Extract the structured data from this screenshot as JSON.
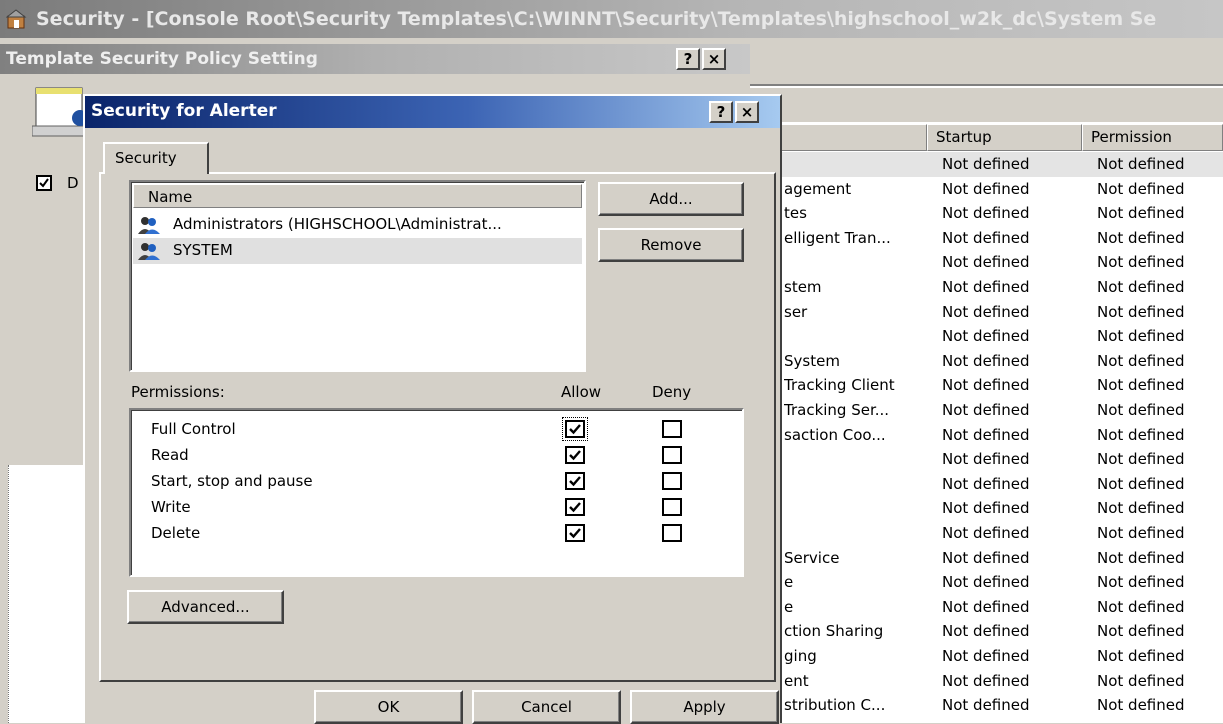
{
  "main_window": {
    "title": "Security - [Console Root\\Security Templates\\C:\\WINNT\\Security\\Templates\\highschool_w2k_dc\\System Se"
  },
  "services_list": {
    "columns": [
      "Startup",
      "Permission"
    ],
    "rows": [
      {
        "name": "",
        "startup": "Not defined",
        "permission": "Not defined"
      },
      {
        "name": "agement",
        "startup": "Not defined",
        "permission": "Not defined"
      },
      {
        "name": "tes",
        "startup": "Not defined",
        "permission": "Not defined"
      },
      {
        "name": "elligent Tran...",
        "startup": "Not defined",
        "permission": "Not defined"
      },
      {
        "name": "",
        "startup": "Not defined",
        "permission": "Not defined"
      },
      {
        "name": "stem",
        "startup": "Not defined",
        "permission": "Not defined"
      },
      {
        "name": "ser",
        "startup": "Not defined",
        "permission": "Not defined"
      },
      {
        "name": "",
        "startup": "Not defined",
        "permission": "Not defined"
      },
      {
        "name": "System",
        "startup": "Not defined",
        "permission": "Not defined"
      },
      {
        "name": "Tracking Client",
        "startup": "Not defined",
        "permission": "Not defined"
      },
      {
        "name": "Tracking Ser...",
        "startup": "Not defined",
        "permission": "Not defined"
      },
      {
        "name": "saction Coo...",
        "startup": "Not defined",
        "permission": "Not defined"
      },
      {
        "name": "",
        "startup": "Not defined",
        "permission": "Not defined"
      },
      {
        "name": "",
        "startup": "Not defined",
        "permission": "Not defined"
      },
      {
        "name": "",
        "startup": "Not defined",
        "permission": "Not defined"
      },
      {
        "name": "",
        "startup": "Not defined",
        "permission": "Not defined"
      },
      {
        "name": "Service",
        "startup": "Not defined",
        "permission": "Not defined"
      },
      {
        "name": "e",
        "startup": "Not defined",
        "permission": "Not defined"
      },
      {
        "name": "e",
        "startup": "Not defined",
        "permission": "Not defined"
      },
      {
        "name": "ction Sharing",
        "startup": "Not defined",
        "permission": "Not defined"
      },
      {
        "name": "ging",
        "startup": "Not defined",
        "permission": "Not defined"
      },
      {
        "name": "ent",
        "startup": "Not defined",
        "permission": "Not defined"
      },
      {
        "name": "stribution C...",
        "startup": "Not defined",
        "permission": "Not defined"
      }
    ]
  },
  "policy_dialog": {
    "title": "Template Security Policy Setting",
    "help_label": "?",
    "close_label": "×",
    "partial_checkbox_label": "D"
  },
  "security_dialog": {
    "title": "Security for Alerter",
    "help_label": "?",
    "close_label": "×",
    "tab_label": "Security",
    "name_header": "Name",
    "principals": [
      {
        "label": "Administrators (HIGHSCHOOL\\Administrat...",
        "selected": false
      },
      {
        "label": "SYSTEM",
        "selected": true
      }
    ],
    "add_label": "Add...",
    "remove_label": "Remove",
    "permissions_label": "Permissions:",
    "allow_label": "Allow",
    "deny_label": "Deny",
    "permissions": [
      {
        "name": "Full Control",
        "allow": true,
        "deny": false
      },
      {
        "name": "Read",
        "allow": true,
        "deny": false
      },
      {
        "name": "Start, stop and pause",
        "allow": true,
        "deny": false
      },
      {
        "name": "Write",
        "allow": true,
        "deny": false
      },
      {
        "name": "Delete",
        "allow": true,
        "deny": false
      }
    ],
    "advanced_label": "Advanced...",
    "ok_label": "OK",
    "cancel_label": "Cancel",
    "apply_label": "Apply"
  },
  "colors": {
    "active_title_start": "#0a246a",
    "active_title_end": "#a6caf0",
    "dialog_face": "#d4d0c8"
  }
}
